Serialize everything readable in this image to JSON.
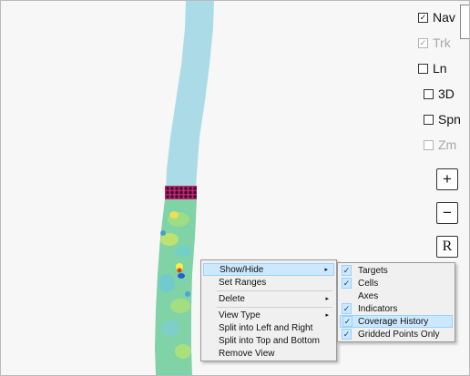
{
  "controls": [
    {
      "label": "Nav",
      "checked": true,
      "enabled": true
    },
    {
      "label": "Trk",
      "checked": true,
      "enabled": false
    },
    {
      "label": "Ln",
      "checked": false,
      "enabled": true
    },
    {
      "label": "3D",
      "checked": false,
      "enabled": true
    },
    {
      "label": "Spn",
      "checked": false,
      "enabled": true
    },
    {
      "label": "Zm",
      "checked": false,
      "enabled": false
    }
  ],
  "buttons": {
    "zoom_in": "+",
    "zoom_out": "−",
    "reset": "R"
  },
  "context_menu": {
    "items": [
      {
        "label": "Show/Hide",
        "submenu": true,
        "highlighted": true
      },
      {
        "label": "Set Ranges",
        "submenu": false
      },
      {
        "label": "Delete",
        "submenu": true
      },
      {
        "label": "View Type",
        "submenu": true
      },
      {
        "label": "Split into Left and Right",
        "submenu": false
      },
      {
        "label": "Split into Top and Bottom",
        "submenu": false
      },
      {
        "label": "Remove View",
        "submenu": false
      }
    ],
    "arrow": "▸"
  },
  "submenu": {
    "items": [
      {
        "label": "Targets",
        "checked": true
      },
      {
        "label": "Cells",
        "checked": true
      },
      {
        "label": "Axes",
        "checked": false
      },
      {
        "label": "Indicators",
        "checked": true
      },
      {
        "label": "Coverage History",
        "checked": true,
        "highlighted": true
      },
      {
        "label": "Gridded Points Only",
        "checked": true
      }
    ],
    "check_glyph": "✓"
  },
  "colors": {
    "track": "#acdbe8",
    "coverage": "#7fd3a6",
    "targets": "#c2246e",
    "menu_bg": "#f0f0f0",
    "highlight": "#cce8ff"
  }
}
